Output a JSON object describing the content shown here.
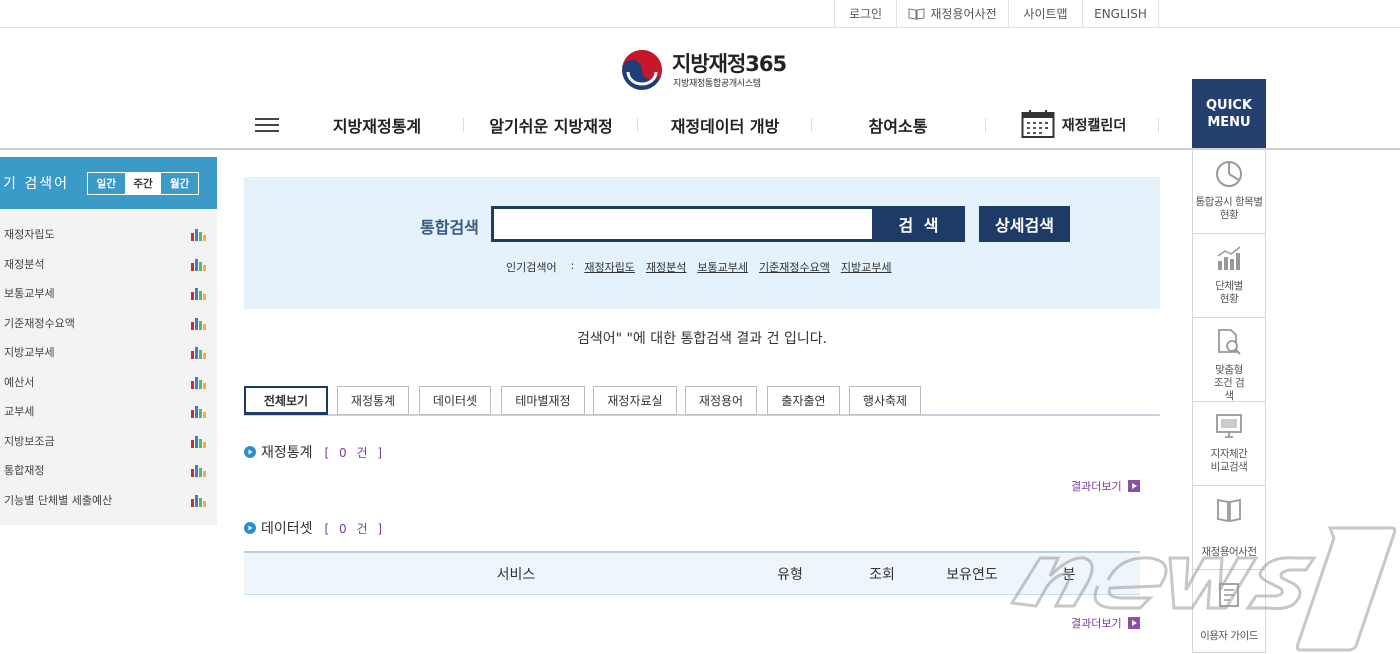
{
  "util_links": [
    {
      "label": "로그인"
    },
    {
      "label": "재정용어사전",
      "icon": "book-icon"
    },
    {
      "label": "사이트맵"
    },
    {
      "label": "ENGLISH"
    }
  ],
  "logo": {
    "title": "지방재정365",
    "subtitle": "지방재정통합공개시스템"
  },
  "gnb": {
    "items": [
      "지방재정통계",
      "알기쉬운 지방재정",
      "재정데이터 개방",
      "참여소통"
    ],
    "calendar_label": "재정캘린더"
  },
  "quick": {
    "button": "QUICK MENU",
    "items": [
      {
        "label": "통합공시 항목별 현황",
        "icon": "pie-chart-icon"
      },
      {
        "label": "단체별 현황",
        "icon": "bar-chart-icon"
      },
      {
        "label": "맞춤형 조건 검색",
        "icon": "document-search-icon"
      },
      {
        "label": "지자체간 비교검색",
        "icon": "monitor-icon"
      },
      {
        "label": "재정용어사전",
        "icon": "book-icon"
      },
      {
        "label": "이용자 가이드",
        "icon": "guide-icon"
      }
    ]
  },
  "sidebar": {
    "title": "기 검색어",
    "tabs": [
      {
        "label": "일간",
        "active": false
      },
      {
        "label": "주간",
        "active": true
      },
      {
        "label": "월간",
        "active": false
      }
    ],
    "items": [
      "재정자립도",
      "재정분석",
      "보통교부세",
      "기준재정수요액",
      "지방교부세",
      "예산서",
      "교부세",
      "지방보조금",
      "통합재정",
      "기능별 단체별 세출예산"
    ]
  },
  "search": {
    "label": "통합검색",
    "value": "",
    "button": "검 색",
    "advanced_button": "상세검색",
    "popular_label": "인기검색어",
    "popular_colon": ":",
    "popular": [
      "재정자립도",
      "재정분석",
      "보통교부세",
      "기준재정수요액",
      "지방교부세"
    ]
  },
  "result_message": "검색어\" \"에 대한 통합검색 결과 건 입니다.",
  "tabs": [
    "전체보기",
    "재정통계",
    "데이터셋",
    "테마별재정",
    "재정자료실",
    "재정용어",
    "출자출연",
    "행사축제"
  ],
  "sections": [
    {
      "title": "재정통계",
      "count": "[ 0 건 ]",
      "more": "결과더보기"
    },
    {
      "title": "데이터셋",
      "count": "[ 0 건 ]",
      "more": "결과더보기"
    }
  ],
  "dataset_table": {
    "columns": [
      "서비스",
      "유형",
      "조회",
      "보유연도",
      "분"
    ]
  },
  "colors": {
    "navy": "#1e3a66",
    "sidebar_blue": "#3b9bc8",
    "accent_purple": "#7a3d9a",
    "search_bg": "#e5f1fb"
  }
}
